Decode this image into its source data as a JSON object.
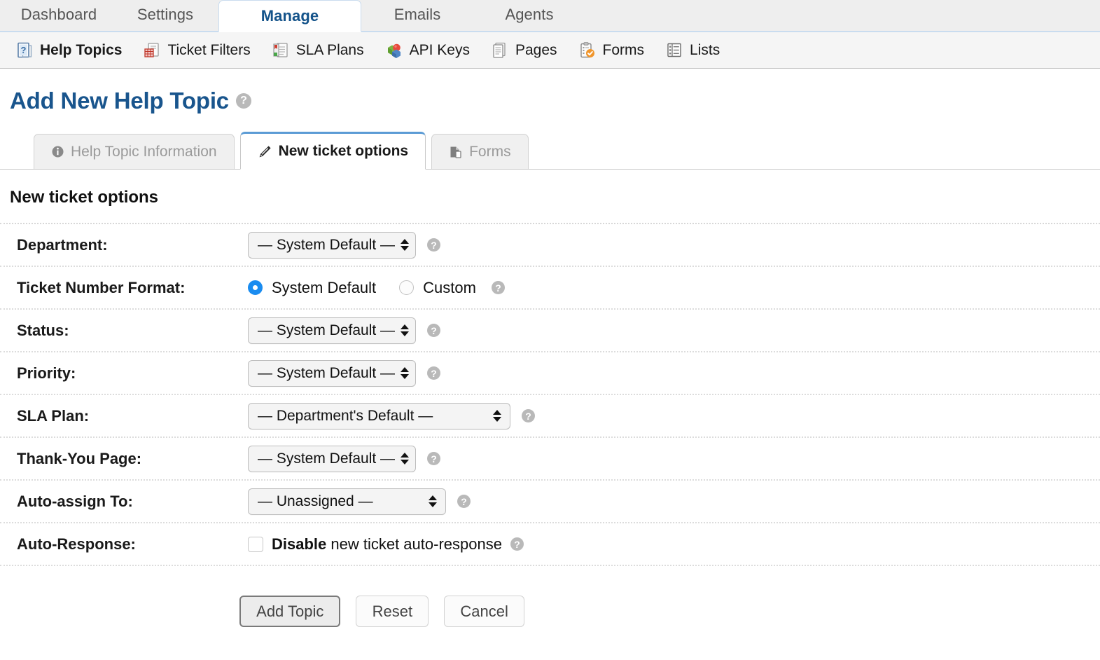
{
  "topnav": {
    "tabs": [
      {
        "label": "Dashboard",
        "active": false
      },
      {
        "label": "Settings",
        "active": false
      },
      {
        "label": "Manage",
        "active": true
      },
      {
        "label": "Emails",
        "active": false
      },
      {
        "label": "Agents",
        "active": false
      }
    ]
  },
  "subnav": {
    "items": [
      {
        "label": "Help Topics",
        "icon": "help-topics-icon",
        "current": true
      },
      {
        "label": "Ticket Filters",
        "icon": "ticket-filters-icon",
        "current": false
      },
      {
        "label": "SLA Plans",
        "icon": "sla-plans-icon",
        "current": false
      },
      {
        "label": "API Keys",
        "icon": "api-keys-icon",
        "current": false
      },
      {
        "label": "Pages",
        "icon": "pages-icon",
        "current": false
      },
      {
        "label": "Forms",
        "icon": "forms-icon",
        "current": false
      },
      {
        "label": "Lists",
        "icon": "lists-icon",
        "current": false
      }
    ]
  },
  "header": {
    "title": "Add New Help Topic",
    "help_glyph": "?"
  },
  "tabs": [
    {
      "label": "Help Topic Information",
      "icon": "info-icon",
      "active": false
    },
    {
      "label": "New ticket options",
      "icon": "pencil-icon",
      "active": true
    },
    {
      "label": "Forms",
      "icon": "form-page-icon",
      "active": false
    }
  ],
  "section": {
    "heading": "New ticket options"
  },
  "form": {
    "rows": [
      {
        "label": "Department:",
        "control": "select",
        "value": "— System Default —",
        "width": "auto",
        "help": "?"
      },
      {
        "label": "Ticket Number Format:",
        "control": "radio",
        "options": [
          {
            "label": "System Default",
            "selected": true
          },
          {
            "label": "Custom",
            "selected": false
          }
        ],
        "help": "?"
      },
      {
        "label": "Status:",
        "control": "select",
        "value": "— System Default —",
        "width": "auto",
        "help": "?"
      },
      {
        "label": "Priority:",
        "control": "select",
        "value": "— System Default —",
        "width": "auto",
        "help": "?"
      },
      {
        "label": "SLA Plan:",
        "control": "select",
        "value": "— Department's Default —",
        "width": "wide",
        "help": "?"
      },
      {
        "label": "Thank-You Page:",
        "control": "select",
        "value": "— System Default —",
        "width": "auto",
        "help": "?"
      },
      {
        "label": "Auto-assign To:",
        "control": "select",
        "value": "— Unassigned —",
        "width": "wide2",
        "help": "?"
      },
      {
        "label": "Auto-Response:",
        "control": "checkbox",
        "checked": false,
        "text_bold": "Disable",
        "text_rest": " new ticket auto-response",
        "help": "?"
      }
    ]
  },
  "buttons": {
    "submit": "Add Topic",
    "reset": "Reset",
    "cancel": "Cancel"
  },
  "colors": {
    "accent_blue": "#19558d",
    "active_tab_border": "#5b9bd5",
    "radio_on": "#1a8cf0",
    "nav_bg": "#eeeeee",
    "subnav_bg": "#f5f5f5"
  }
}
